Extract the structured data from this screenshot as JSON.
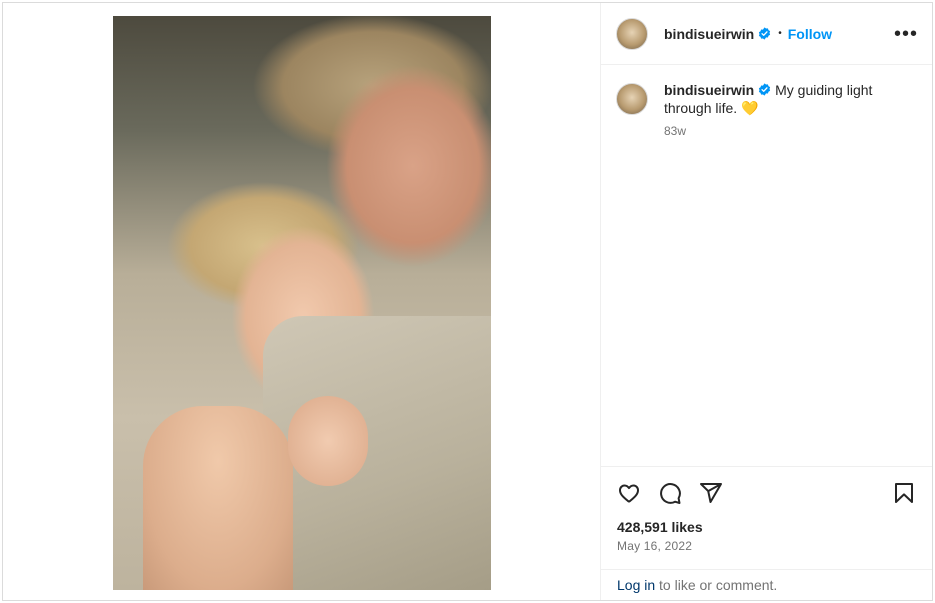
{
  "post": {
    "username": "bindisueirwin",
    "follow_label": "Follow",
    "separator": "•",
    "more_label": "•••",
    "caption": "My guiding light through life. 💛",
    "age": "83w",
    "likes": "428,591 likes",
    "date": "May 16, 2022"
  },
  "footer": {
    "login_label": "Log in",
    "login_suffix": " to like or comment."
  },
  "icons": {
    "verified": "verified-badge-icon",
    "like": "heart-icon",
    "comment": "comment-icon",
    "share": "share-icon",
    "save": "bookmark-icon"
  },
  "colors": {
    "accent": "#0095f6",
    "link": "#00376b",
    "muted": "#737373",
    "verified": "#0095f6"
  }
}
